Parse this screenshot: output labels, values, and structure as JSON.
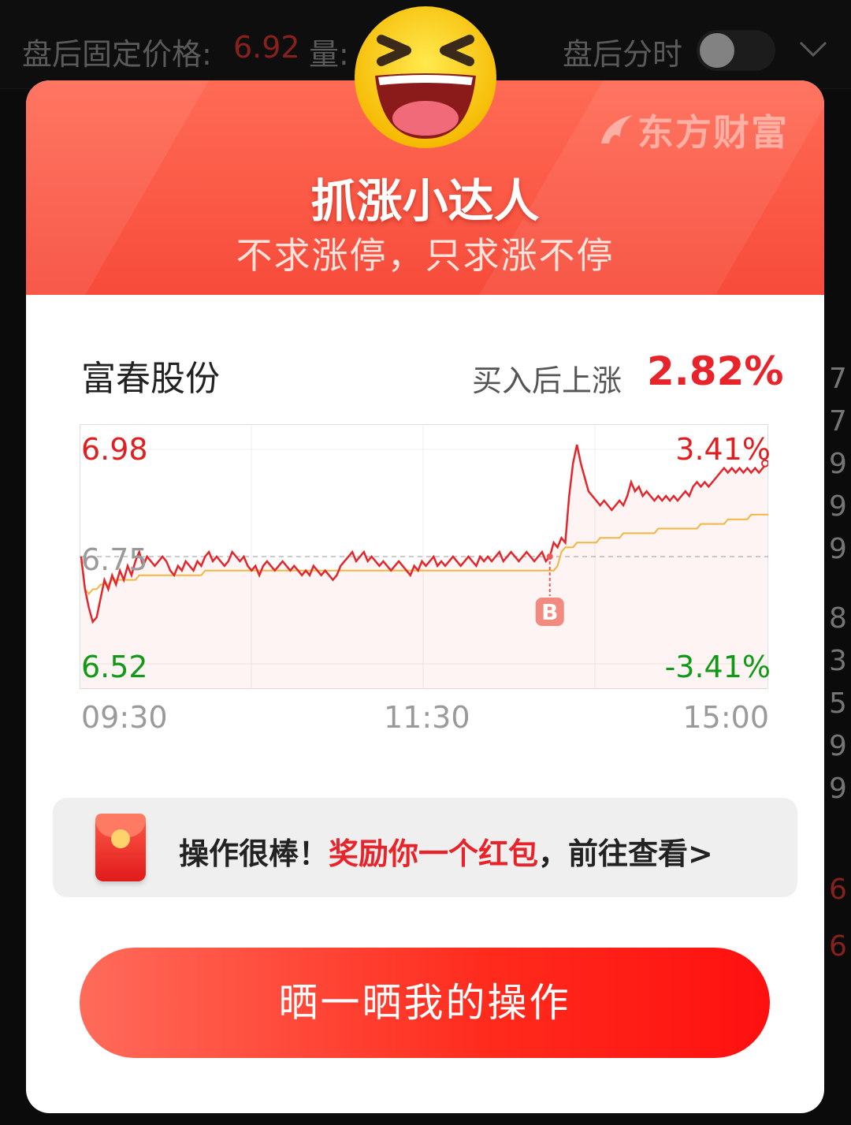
{
  "background": {
    "after_hours_label": "盘后固定价格:",
    "after_hours_price": "6.92",
    "volume_label": "量:",
    "after_hours_timeshare_label": "盘后分时",
    "right_numbers": [
      "7",
      "7",
      "9",
      "9",
      "9",
      "8",
      "3",
      "5",
      "9",
      "9",
      "6",
      "6"
    ]
  },
  "modal": {
    "brand": "东方财富",
    "title": "抓涨小达人",
    "subtitle": "不求涨停，只求涨不停",
    "stock_name": "富春股份",
    "gain_label": "买入后上涨",
    "gain_value": "2.82%",
    "reward_prefix": "操作很棒！",
    "reward_highlight": "奖励你一个红包",
    "reward_suffix": "，前往查看>",
    "share_button": "晒一晒我的操作"
  },
  "chart_data": {
    "type": "line",
    "y_high": "6.98",
    "y_mid": "6.75",
    "y_low": "6.52",
    "pct_high": "3.41%",
    "pct_low": "-3.41%",
    "x_ticks": [
      "09:30",
      "11:30",
      "15:00"
    ],
    "ylim": [
      6.52,
      6.98
    ],
    "buy_marker": "B",
    "buy_time_index": 121,
    "series": [
      {
        "values": [
          6.75,
          6.68,
          6.64,
          6.61,
          6.62,
          6.66,
          6.7,
          6.68,
          6.71,
          6.69,
          6.72,
          6.7,
          6.73,
          6.71,
          6.74,
          6.76,
          6.73,
          6.75,
          6.74,
          6.73,
          6.74,
          6.75,
          6.74,
          6.72,
          6.71,
          6.73,
          6.72,
          6.74,
          6.73,
          6.72,
          6.74,
          6.73,
          6.75,
          6.76,
          6.74,
          6.75,
          6.74,
          6.73,
          6.74,
          6.76,
          6.75,
          6.74,
          6.75,
          6.73,
          6.72,
          6.73,
          6.71,
          6.73,
          6.74,
          6.73,
          6.72,
          6.73,
          6.74,
          6.73,
          6.72,
          6.73,
          6.72,
          6.71,
          6.72,
          6.71,
          6.73,
          6.72,
          6.71,
          6.72,
          6.71,
          6.7,
          6.71,
          6.73,
          6.74,
          6.75,
          6.76,
          6.74,
          6.75,
          6.76,
          6.74,
          6.75,
          6.74,
          6.73,
          6.74,
          6.73,
          6.72,
          6.73,
          6.74,
          6.73,
          6.72,
          6.71,
          6.73,
          6.72,
          6.74,
          6.73,
          6.74,
          6.75,
          6.73,
          6.74,
          6.73,
          6.74,
          6.75,
          6.74,
          6.73,
          6.74,
          6.75,
          6.74,
          6.73,
          6.75,
          6.74,
          6.75,
          6.74,
          6.75,
          6.76,
          6.74,
          6.75,
          6.76,
          6.75,
          6.74,
          6.75,
          6.76,
          6.75,
          6.74,
          6.75,
          6.76,
          6.74,
          6.75,
          6.78,
          6.77,
          6.79,
          6.78,
          6.88,
          6.95,
          6.99,
          6.95,
          6.92,
          6.89,
          6.88,
          6.87,
          6.86,
          6.87,
          6.86,
          6.85,
          6.86,
          6.87,
          6.86,
          6.88,
          6.91,
          6.89,
          6.9,
          6.88,
          6.89,
          6.88,
          6.87,
          6.88,
          6.87,
          6.88,
          6.87,
          6.88,
          6.87,
          6.88,
          6.89,
          6.88,
          6.9,
          6.91,
          6.9,
          6.91,
          6.9,
          6.91,
          6.92,
          6.93,
          6.94,
          6.93,
          6.94,
          6.93,
          6.94,
          6.93,
          6.94,
          6.93,
          6.94,
          6.93,
          6.94,
          6.95
        ]
      },
      {
        "values": [
          6.74,
          6.68,
          6.67,
          6.68,
          6.68,
          6.69,
          6.69,
          6.69,
          6.7,
          6.7,
          6.7,
          6.7,
          6.7,
          6.7,
          6.7,
          6.71,
          6.71,
          6.71,
          6.71,
          6.71,
          6.71,
          6.71,
          6.71,
          6.71,
          6.71,
          6.71,
          6.71,
          6.71,
          6.71,
          6.71,
          6.71,
          6.71,
          6.72,
          6.72,
          6.72,
          6.72,
          6.72,
          6.72,
          6.72,
          6.72,
          6.72,
          6.72,
          6.72,
          6.72,
          6.72,
          6.72,
          6.72,
          6.72,
          6.72,
          6.72,
          6.72,
          6.72,
          6.72,
          6.72,
          6.72,
          6.72,
          6.72,
          6.72,
          6.72,
          6.72,
          6.72,
          6.72,
          6.72,
          6.72,
          6.72,
          6.72,
          6.72,
          6.72,
          6.72,
          6.72,
          6.72,
          6.72,
          6.72,
          6.72,
          6.72,
          6.72,
          6.72,
          6.72,
          6.72,
          6.72,
          6.72,
          6.72,
          6.72,
          6.72,
          6.72,
          6.72,
          6.72,
          6.72,
          6.72,
          6.72,
          6.72,
          6.72,
          6.72,
          6.72,
          6.72,
          6.72,
          6.72,
          6.72,
          6.72,
          6.72,
          6.72,
          6.72,
          6.72,
          6.72,
          6.72,
          6.72,
          6.72,
          6.72,
          6.72,
          6.72,
          6.72,
          6.72,
          6.72,
          6.72,
          6.72,
          6.72,
          6.72,
          6.72,
          6.72,
          6.72,
          6.72,
          6.72,
          6.72,
          6.73,
          6.76,
          6.77,
          6.77,
          6.77,
          6.78,
          6.78,
          6.78,
          6.78,
          6.78,
          6.78,
          6.79,
          6.79,
          6.79,
          6.79,
          6.79,
          6.79,
          6.8,
          6.8,
          6.8,
          6.8,
          6.8,
          6.8,
          6.8,
          6.8,
          6.8,
          6.81,
          6.81,
          6.81,
          6.81,
          6.81,
          6.81,
          6.81,
          6.81,
          6.81,
          6.81,
          6.81,
          6.82,
          6.82,
          6.82,
          6.82,
          6.82,
          6.82,
          6.82,
          6.83,
          6.83,
          6.83,
          6.83,
          6.83,
          6.83,
          6.84,
          6.84,
          6.84,
          6.84,
          6.84,
          6.84,
          6.84
        ]
      }
    ]
  }
}
